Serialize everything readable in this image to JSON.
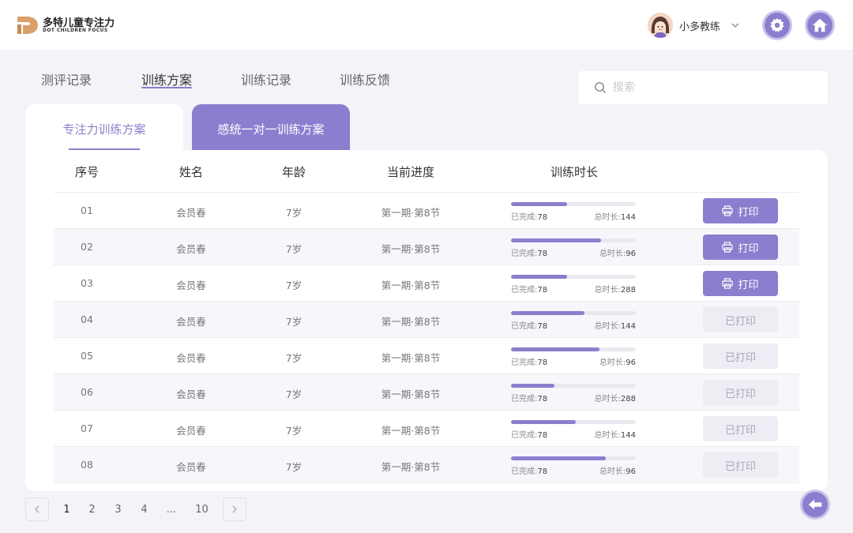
{
  "brand": {
    "name_cn": "多特儿童专注力",
    "name_en": "DOT CHILDREN FOCUS",
    "accent": "#8a7fce",
    "logo_color": "#d9a06a"
  },
  "user": {
    "name": "小多教练"
  },
  "nav": {
    "tabs": [
      {
        "label": "测评记录",
        "active": false
      },
      {
        "label": "训练方案",
        "active": true
      },
      {
        "label": "训练记录",
        "active": false
      },
      {
        "label": "训练反馈",
        "active": false
      }
    ]
  },
  "search": {
    "placeholder": "搜索"
  },
  "subtabs": [
    {
      "label": "专注力训练方案",
      "active": true
    },
    {
      "label": "感统一对一训练方案",
      "active": false
    }
  ],
  "table": {
    "headers": [
      "序号",
      "姓名",
      "年龄",
      "当前进度",
      "训练时长"
    ],
    "done_prefix": "已完成:",
    "total_prefix": "总时长:",
    "rows": [
      {
        "no": "01",
        "name": "会员春",
        "age": "7岁",
        "progress": "第一期·第8节",
        "done": "78",
        "total": "144",
        "pct": 0.45,
        "action": "打印",
        "printed": false
      },
      {
        "no": "02",
        "name": "会员春",
        "age": "7岁",
        "progress": "第一期·第8节",
        "done": "78",
        "total": "96",
        "pct": 0.72,
        "action": "打印",
        "printed": false
      },
      {
        "no": "03",
        "name": "会员春",
        "age": "7岁",
        "progress": "第一期·第8节",
        "done": "78",
        "total": "288",
        "pct": 0.45,
        "action": "打印",
        "printed": false
      },
      {
        "no": "04",
        "name": "会员春",
        "age": "7岁",
        "progress": "第一期·第8节",
        "done": "78",
        "total": "144",
        "pct": 0.59,
        "action": "已打印",
        "printed": true
      },
      {
        "no": "05",
        "name": "会员春",
        "age": "7岁",
        "progress": "第一期·第8节",
        "done": "78",
        "total": "96",
        "pct": 0.71,
        "action": "已打印",
        "printed": true
      },
      {
        "no": "06",
        "name": "会员春",
        "age": "7岁",
        "progress": "第一期·第8节",
        "done": "78",
        "total": "288",
        "pct": 0.35,
        "action": "已打印",
        "printed": true
      },
      {
        "no": "07",
        "name": "会员春",
        "age": "7岁",
        "progress": "第一期·第8节",
        "done": "78",
        "total": "144",
        "pct": 0.52,
        "action": "已打印",
        "printed": true
      },
      {
        "no": "08",
        "name": "会员春",
        "age": "7岁",
        "progress": "第一期·第8节",
        "done": "78",
        "total": "96",
        "pct": 0.76,
        "action": "已打印",
        "printed": true
      }
    ]
  },
  "pagination": {
    "pages": [
      "1",
      "2",
      "3",
      "4",
      "...",
      "10"
    ],
    "current": "1"
  },
  "icons": {
    "settings": "gear-icon",
    "home": "home-icon",
    "back": "back-arrow-icon",
    "search": "search-icon",
    "print": "printer-icon",
    "dropdown": "chevron-down-icon"
  }
}
